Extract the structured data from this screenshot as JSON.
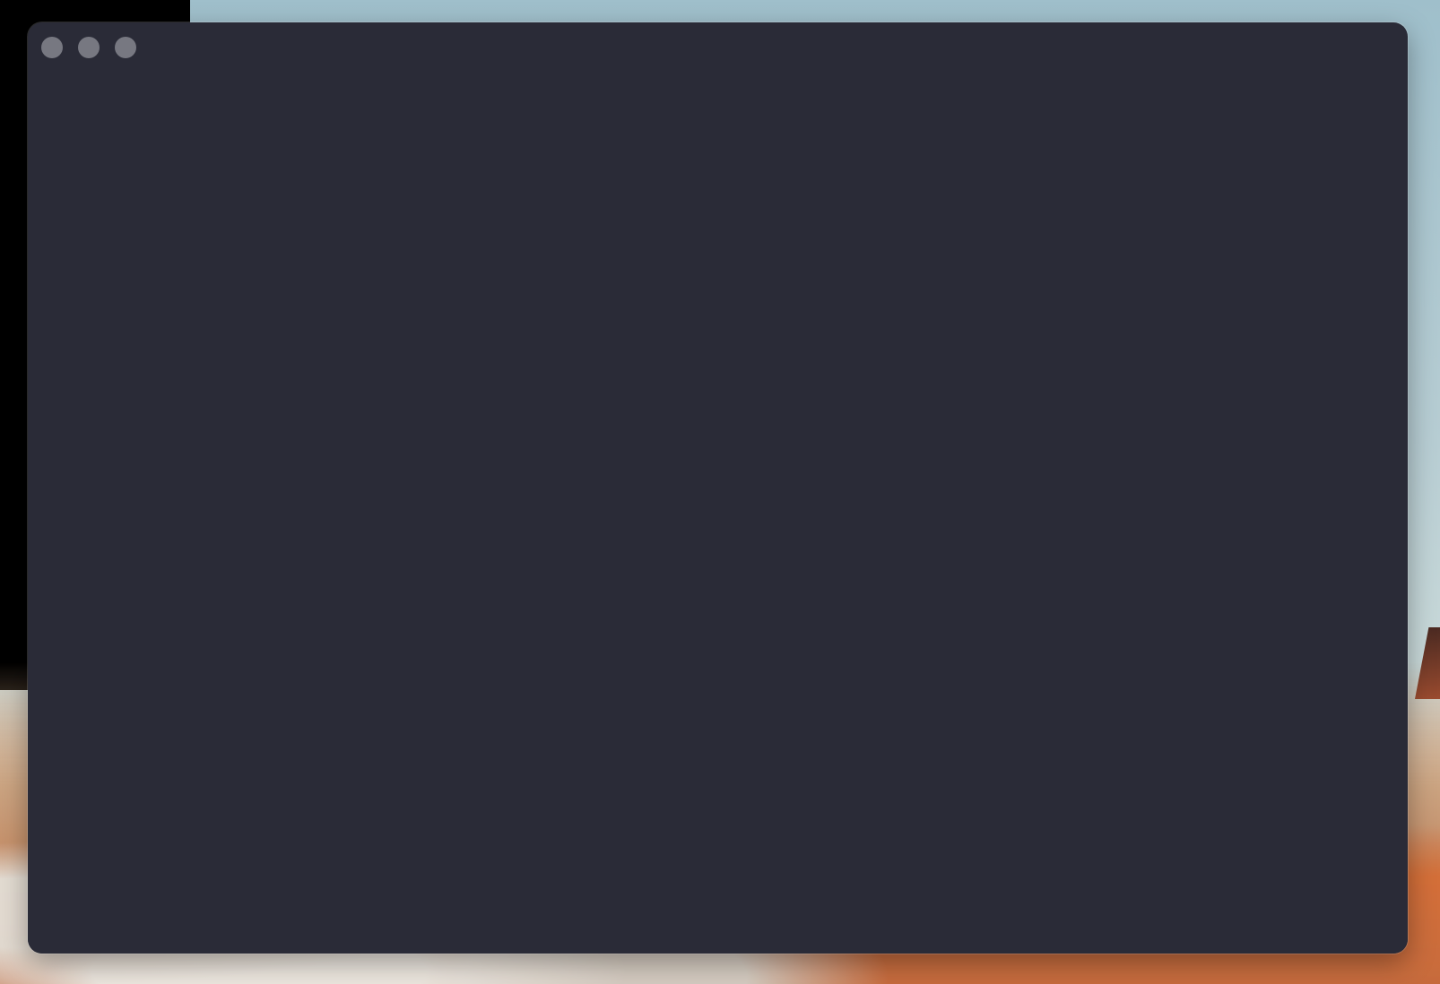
{
  "desktop": {
    "wallpaper_colors": [
      "#9fbfcb",
      "#c9d9d9",
      "#c98a5d",
      "#a9542f"
    ],
    "left_panel_color": "#000000"
  },
  "window": {
    "background_color": "#2a2b37",
    "titlebar": {
      "controls": [
        {
          "name": "close-button",
          "icon": "circle-icon",
          "color": "#777881"
        },
        {
          "name": "minimize-button",
          "icon": "circle-icon",
          "color": "#777881"
        },
        {
          "name": "zoom-button",
          "icon": "circle-icon",
          "color": "#777881"
        }
      ]
    },
    "content": {
      "text": ""
    }
  }
}
